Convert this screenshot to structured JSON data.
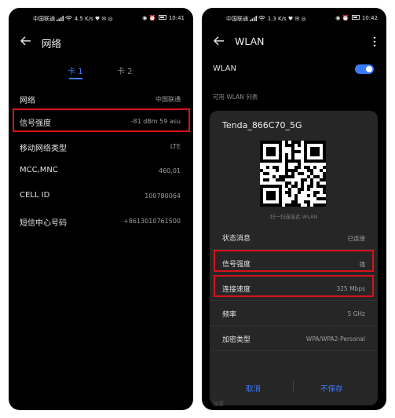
{
  "left_phone": {
    "status_bar": {
      "carrier": "中国联通",
      "net_speed": "4.5 K/s",
      "time": "10:41"
    },
    "title": "网络",
    "tabs": [
      "卡 1",
      "卡 2"
    ],
    "rows": [
      {
        "label": "网络",
        "value": "中国联通"
      },
      {
        "label": "信号强度",
        "value": "-81 dBm   59 asu",
        "highlighted": true
      },
      {
        "label": "移动网络类型",
        "value": "LTE"
      },
      {
        "label": "MCC,MNC",
        "value": "460,01"
      },
      {
        "label": "CELL ID",
        "value": "100780064"
      },
      {
        "label": "短信中心号码",
        "value": "+8613010761500"
      }
    ]
  },
  "right_phone": {
    "status_bar": {
      "carrier": "中国联通",
      "net_speed": "1.3 K/s",
      "time": "10:42"
    },
    "title": "WLAN",
    "wlan_toggle_label": "WLAN",
    "wlan_enabled": true,
    "section_header": "可用 WLAN 列表",
    "dialog": {
      "ssid": "Tenda_866C70_5G",
      "qr_caption": "扫一扫连接此 WLAN",
      "rows": [
        {
          "label": "状态消息",
          "value": "已连接"
        },
        {
          "label": "信号强度",
          "value": "强",
          "highlighted": true
        },
        {
          "label": "连接速度",
          "value": "325 Mbps",
          "highlighted": true
        },
        {
          "label": "频率",
          "value": "5 GHz"
        },
        {
          "label": "加密类型",
          "value": "WPA/WPA2-Personal"
        }
      ],
      "cancel_label": "取消",
      "nosave_label": "不保存"
    },
    "peek_text": "加密"
  },
  "colors": {
    "accent": "#3b7cff",
    "highlight": "#d6121a",
    "background": "#000000"
  }
}
